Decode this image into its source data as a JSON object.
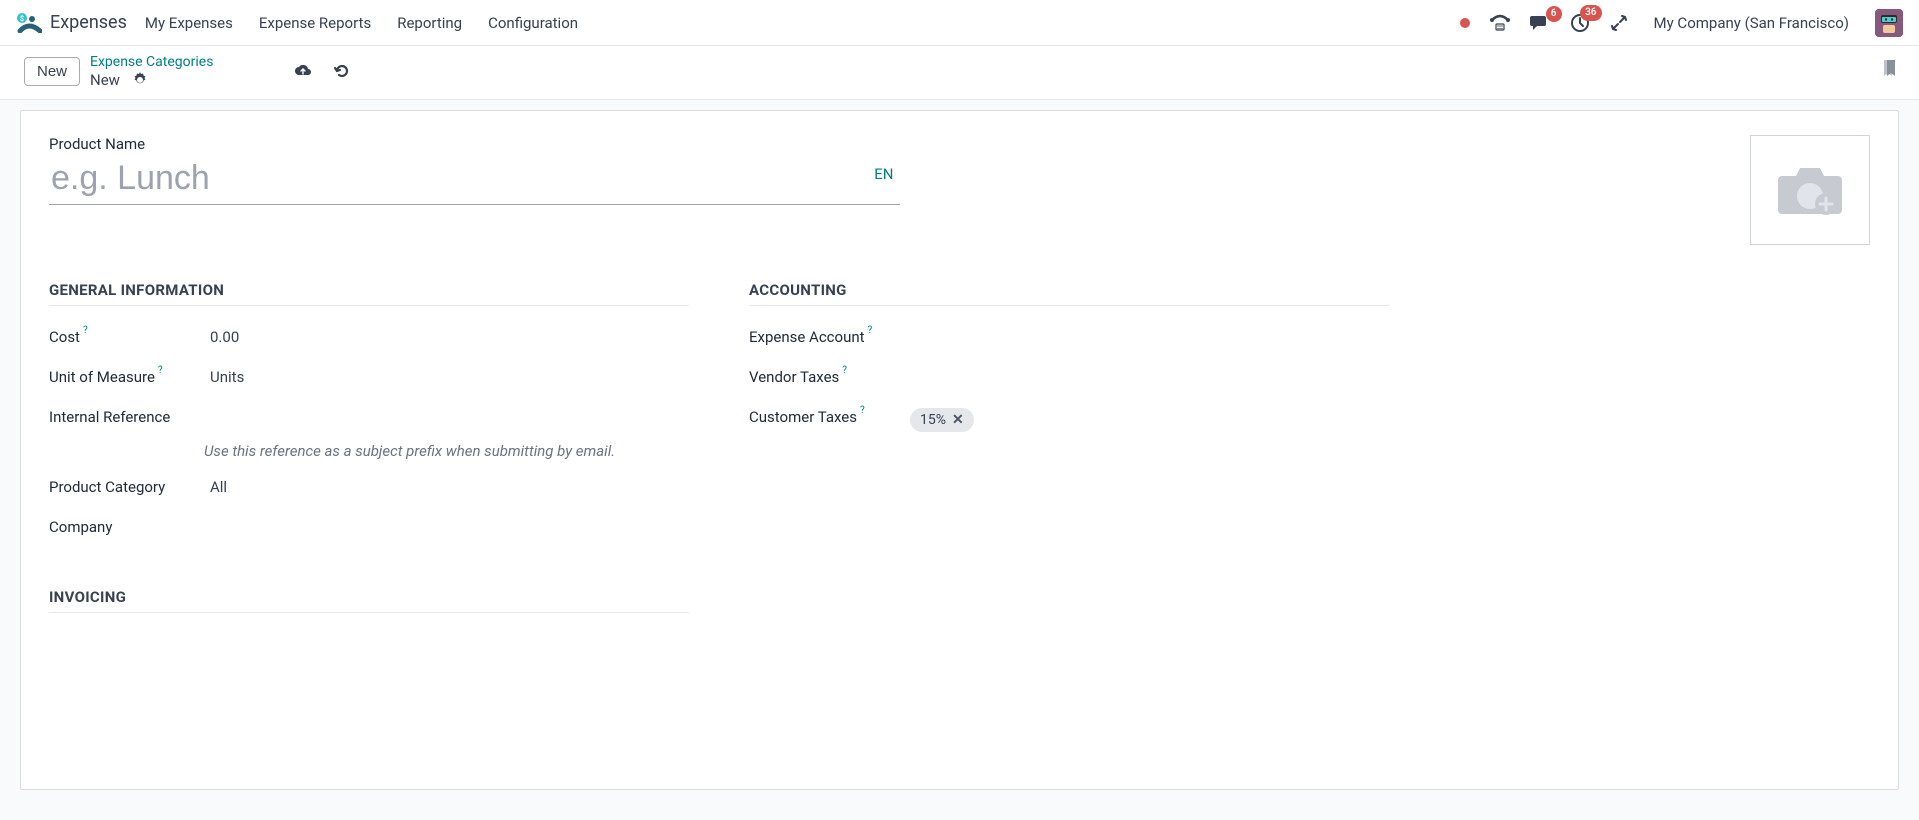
{
  "nav": {
    "appName": "Expenses",
    "items": [
      "My Expenses",
      "Expense Reports",
      "Reporting",
      "Configuration"
    ]
  },
  "systray": {
    "messagesBadge": "6",
    "activitiesBadge": "36",
    "companyName": "My Company (San Francisco)"
  },
  "breadcrumb": {
    "newButton": "New",
    "parent": "Expense Categories",
    "current": "New"
  },
  "form": {
    "productNameLabel": "Product Name",
    "productNamePlaceholder": "e.g. Lunch",
    "productNameValue": "",
    "langBadge": "EN",
    "sections": {
      "general": {
        "title": "GENERAL INFORMATION",
        "costLabel": "Cost",
        "costValue": "0.00",
        "uomLabel": "Unit of Measure",
        "uomValue": "Units",
        "internalRefLabel": "Internal Reference",
        "internalRefHint": "Use this reference as a subject prefix when submitting by email.",
        "productCategoryLabel": "Product Category",
        "productCategoryValue": "All",
        "companyLabel": "Company",
        "companyValue": ""
      },
      "accounting": {
        "title": "ACCOUNTING",
        "expenseAccountLabel": "Expense Account",
        "vendorTaxesLabel": "Vendor Taxes",
        "customerTaxesLabel": "Customer Taxes",
        "customerTaxesTag": "15%"
      },
      "invoicing": {
        "title": "INVOICING"
      }
    }
  }
}
